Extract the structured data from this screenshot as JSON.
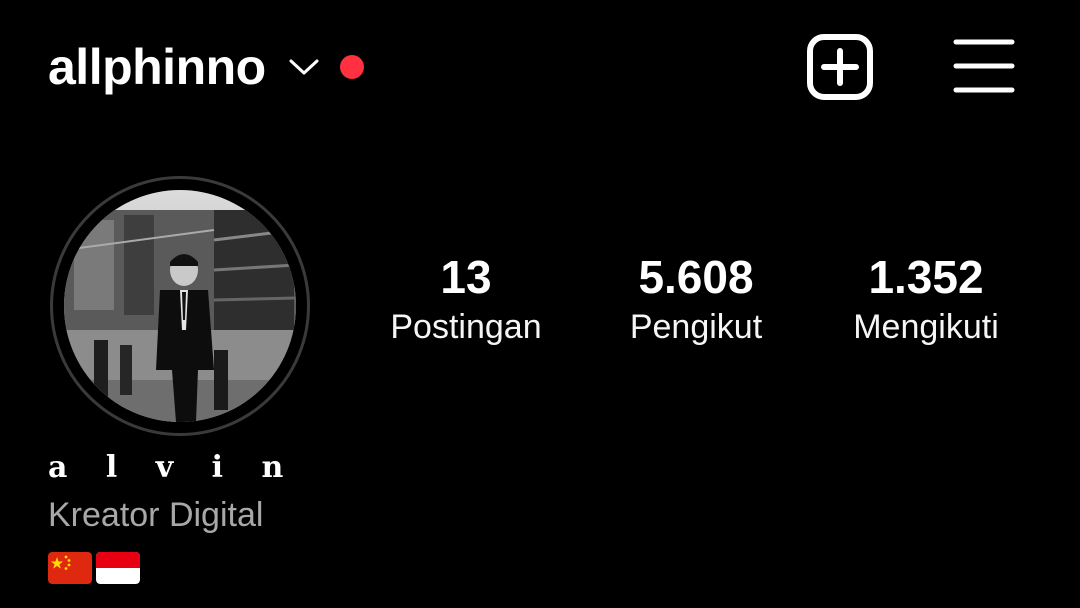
{
  "header": {
    "username": "allphinno",
    "icons": {
      "account_switcher": "chevron-down-icon",
      "notification": "red-dot-icon",
      "new_post": "plus-square-icon",
      "menu": "hamburger-menu-icon"
    },
    "notification_color": "#ff3040"
  },
  "profile": {
    "avatar": "profile-photo",
    "display_name": "a l v i n",
    "category": "Kreator Digital",
    "bio_flags": [
      "china-flag",
      "indonesia-flag"
    ]
  },
  "stats": [
    {
      "value": "13",
      "label": "Postingan"
    },
    {
      "value": "5.608",
      "label": "Pengikut"
    },
    {
      "value": "1.352",
      "label": "Mengikuti"
    }
  ],
  "colors": {
    "background": "#000000",
    "text": "#ffffff",
    "secondary_text": "#a8a8a8"
  }
}
